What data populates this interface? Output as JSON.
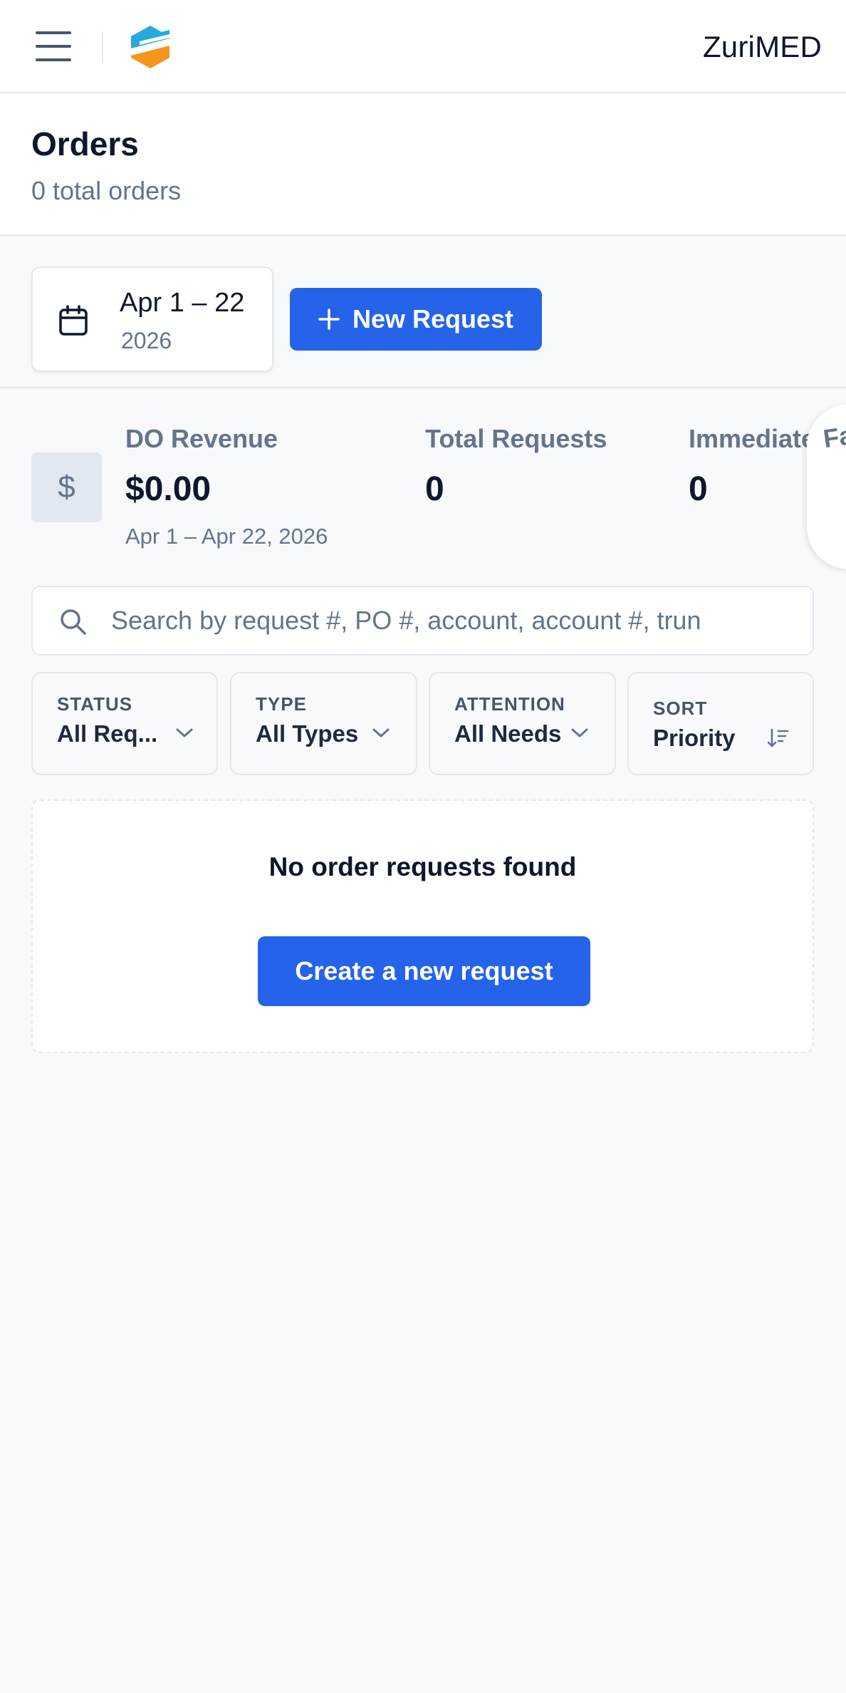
{
  "header": {
    "brand": "ZuriMED",
    "logo_colors": {
      "blue": "#29a8e0",
      "orange": "#f7941d"
    }
  },
  "page": {
    "title": "Orders",
    "subtitle": "0 total orders"
  },
  "toolbar": {
    "date_range": "Apr 1 – 22",
    "date_year": "2026",
    "new_request_label": "New Request"
  },
  "stats": {
    "revenue": {
      "label": "DO Revenue",
      "value": "$0.00",
      "note": "Apr 1 – Apr 22, 2026",
      "icon": "$"
    },
    "total_requests": {
      "label": "Total Requests",
      "value": "0"
    },
    "immediate": {
      "label": "Immediate",
      "value": "0"
    },
    "side_card_label": "Fa R"
  },
  "search": {
    "placeholder": "Search by request #, PO #, account, account #, trun",
    "value": ""
  },
  "filters": [
    {
      "label": "STATUS",
      "value": "All Req..."
    },
    {
      "label": "TYPE",
      "value": "All Types"
    },
    {
      "label": "ATTENTION",
      "value": "All Needs"
    },
    {
      "label": "SORT",
      "value": "Priority"
    }
  ],
  "empty_state": {
    "title": "No order requests found",
    "button_label": "Create a new request"
  },
  "colors": {
    "primary": "#2563eb",
    "text": "#0f172a",
    "muted": "#64748b",
    "border": "#e2e8f0",
    "background": "#f8f9fb"
  }
}
